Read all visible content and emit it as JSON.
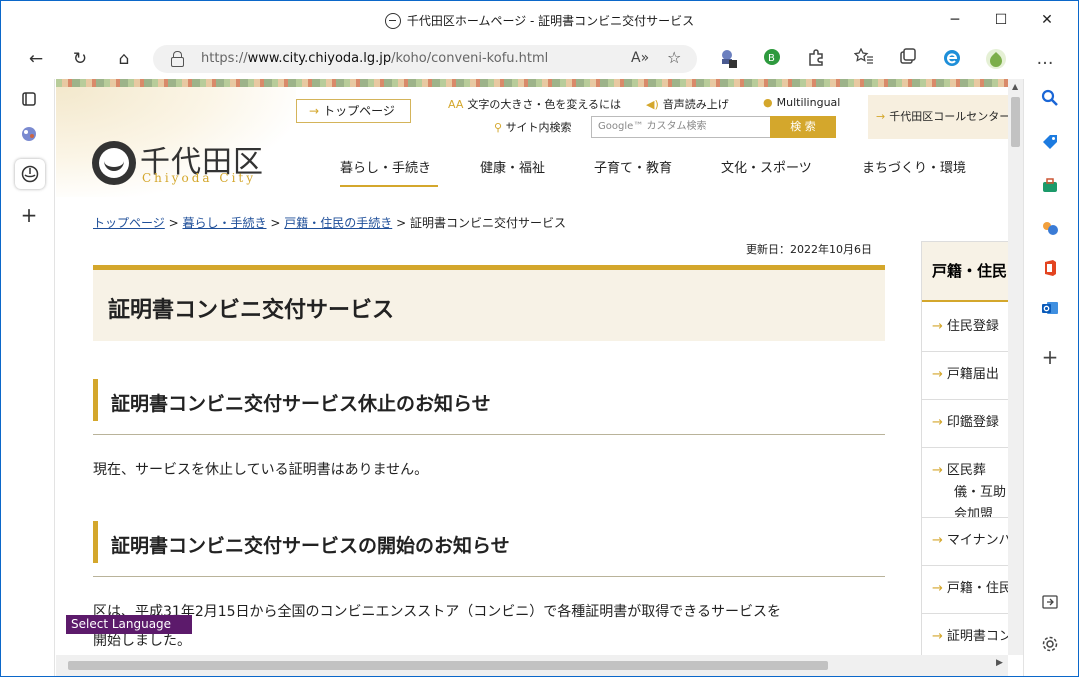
{
  "window": {
    "title": "千代田区ホームページ - 証明書コンビニ交付サービス",
    "minimize": "─",
    "maximize": "☐",
    "close": "✕"
  },
  "toolbar": {
    "back": "←",
    "refresh": "↻",
    "home": "⌂",
    "url_prefix": "https://",
    "url_host": "www.city.chiyoda.lg.jp",
    "url_path": "/koho/conveni-kofu.html",
    "read_aloud": "A»",
    "favorite": "☆",
    "ext_badge": "1",
    "ext_b": "B",
    "more": "…"
  },
  "site": {
    "top_page_button": "トップページ",
    "text_size": "文字の大きさ・色を変えるには",
    "read_aloud": "音声読み上げ",
    "multilingual": "Multilingual",
    "search_label": "サイト内検索",
    "search_placeholder": "Google™ カスタム検索",
    "search_button": "検 索",
    "call_center": "千代田区コールセンター",
    "logo_jp": "千代田区",
    "logo_en": "Chiyoda City",
    "nav": [
      "暮らし・手続き",
      "健康・福祉",
      "子育て・教育",
      "文化・スポーツ",
      "まちづくり・環境"
    ]
  },
  "breadcrumb": {
    "items": [
      "トップページ",
      "暮らし・手続き",
      "戸籍・住民の手続き"
    ],
    "current": "証明書コンビニ交付サービス",
    "sep": ">"
  },
  "content": {
    "updated": "更新日：2022年10月6日",
    "title": "証明書コンビニ交付サービス",
    "section1_heading": "証明書コンビニ交付サービス休止のお知らせ",
    "section1_text": "現在、サービスを休止している証明書はありません。",
    "section2_heading": "証明書コンビニ交付サービスの開始のお知らせ",
    "section2_line1": "区は、平成31年2月15日から全国のコンビニエンスストア（コンビニ）で各種証明書が取得できるサービスを",
    "section2_line2": "開始しました。"
  },
  "sidebar_menu": {
    "heading": "戸籍・住民の手続き",
    "items": [
      "住民登録",
      "戸籍届出",
      "印鑑登録",
      "区民葬儀・互助会加盟",
      "マイナンバー",
      "戸籍・住民",
      "証明書コンビニ"
    ]
  },
  "select_language": "Select Language"
}
